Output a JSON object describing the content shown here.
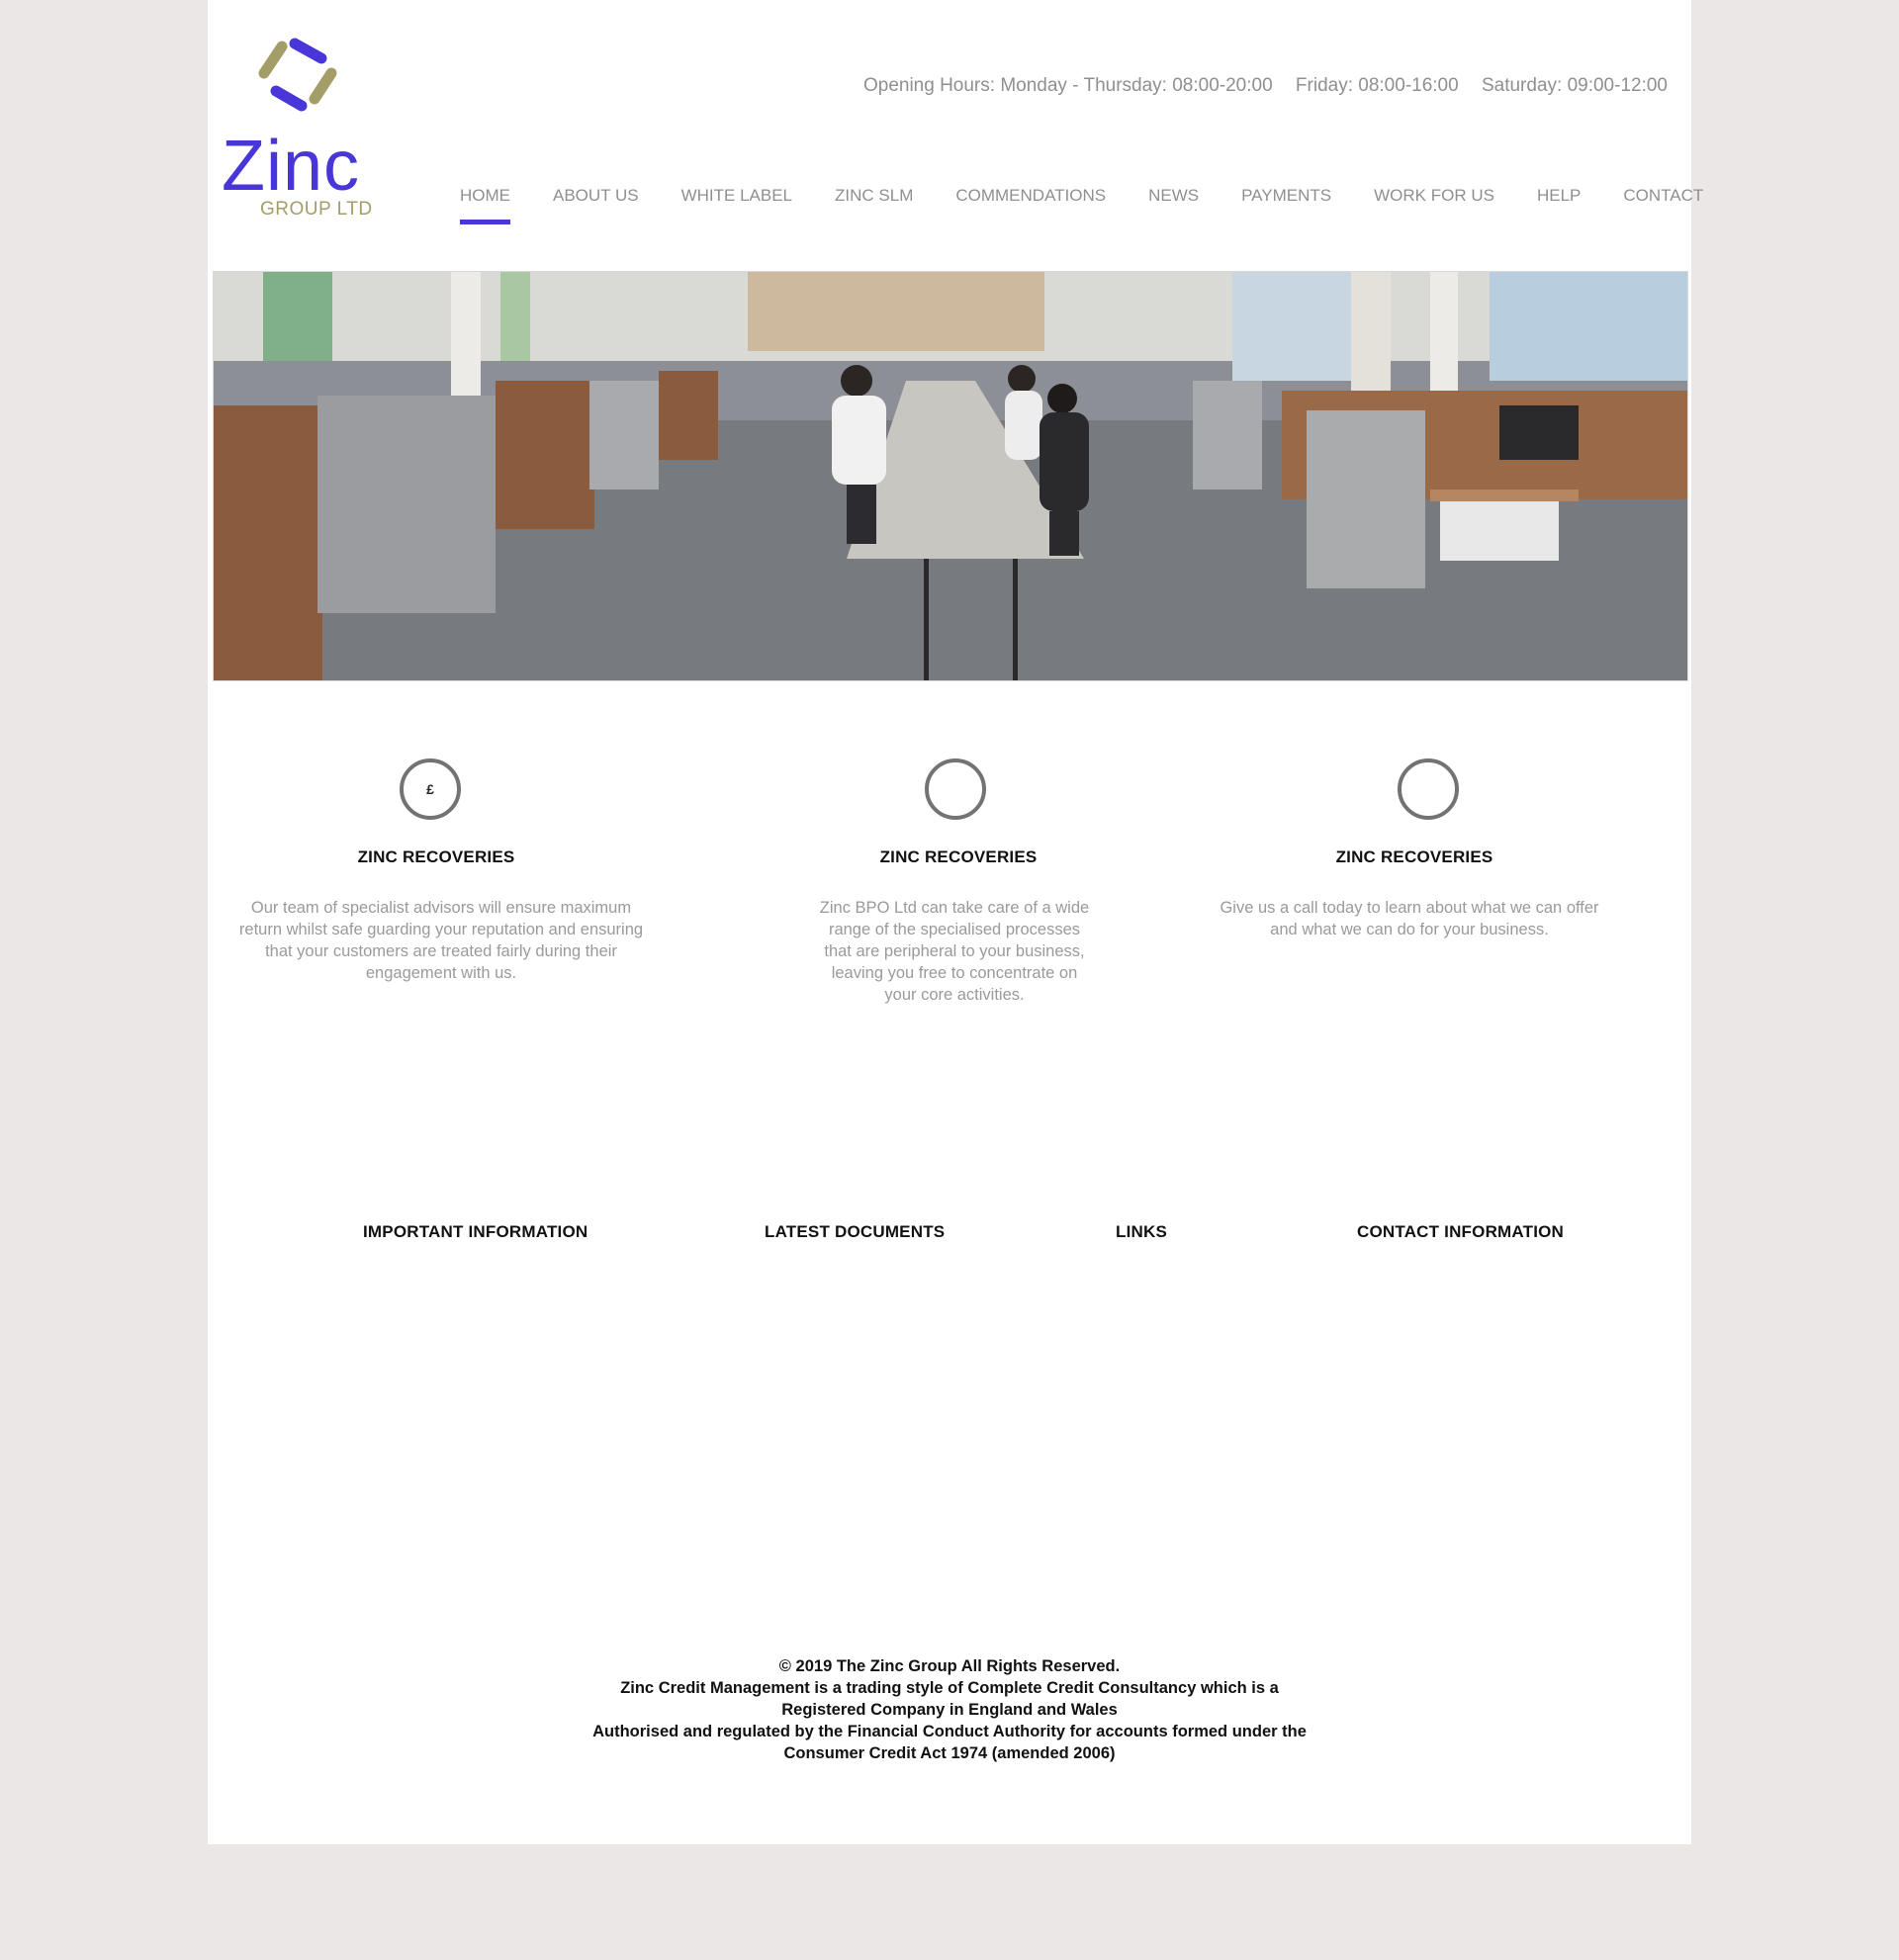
{
  "brand": {
    "logo_word": "Zinc",
    "logo_sub": "GROUP LTD",
    "colors": {
      "primary": "#4836d8",
      "olive": "#a39e68"
    }
  },
  "header": {
    "hours": [
      "Opening Hours: Monday - Thursday: 08:00-20:00",
      "Friday: 08:00-16:00",
      "Saturday: 09:00-12:00"
    ]
  },
  "nav": {
    "items": [
      {
        "label": "HOME",
        "active": true
      },
      {
        "label": "ABOUT US"
      },
      {
        "label": "WHITE LABEL"
      },
      {
        "label": "ZINC SLM"
      },
      {
        "label": "COMMENDATIONS"
      },
      {
        "label": "NEWS"
      },
      {
        "label": "PAYMENTS"
      },
      {
        "label": "WORK FOR US"
      },
      {
        "label": "HELP"
      },
      {
        "label": "CONTACT"
      }
    ]
  },
  "hero": {
    "image": "office-photo"
  },
  "features": [
    {
      "icon": "£",
      "title": "ZINC RECOVERIES",
      "text": "Our team of specialist advisors will ensure maximum return whilst safe guarding your reputation and ensuring that your customers are treated fairly during their engagement with us."
    },
    {
      "icon": "",
      "title": "ZINC RECOVERIES",
      "text": "Zinc BPO Ltd can take care of a wide range of the specialised processes that are peripheral to your business, leaving you free to concentrate on your core activities."
    },
    {
      "icon": "",
      "title": "ZINC RECOVERIES",
      "text": "Give us a call today to learn about what we can offer and what we can do for your business."
    }
  ],
  "footer": {
    "headings": [
      "IMPORTANT INFORMATION",
      "LATEST DOCUMENTS",
      "LINKS",
      "CONTACT INFORMATION"
    ],
    "copyright": [
      "© 2019 The Zinc Group All Rights Reserved.",
      "Zinc Credit Management is a trading style of Complete Credit Consultancy which is a",
      "Registered Company in England and Wales",
      "Authorised and regulated by the Financial Conduct Authority for accounts formed under the",
      "Consumer Credit Act 1974 (amended 2006)"
    ]
  }
}
